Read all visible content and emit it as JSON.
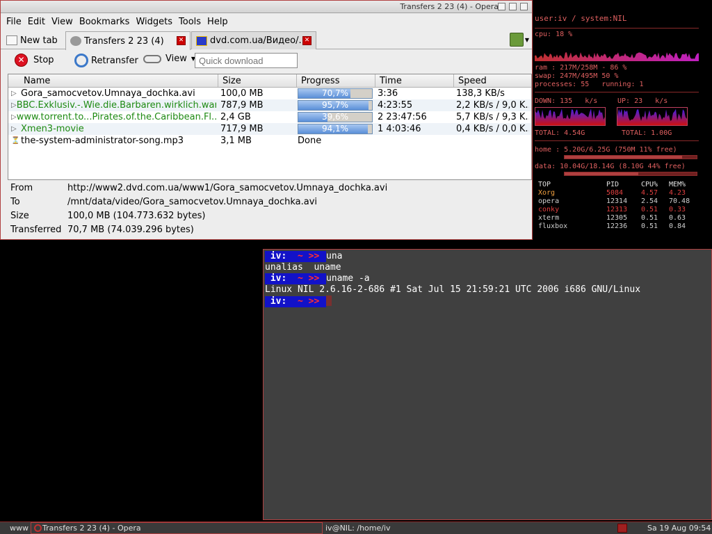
{
  "opera": {
    "title": "Transfers 2 23 (4) - Opera",
    "menu": [
      "File",
      "Edit",
      "View",
      "Bookmarks",
      "Widgets",
      "Tools",
      "Help"
    ],
    "tabs": [
      {
        "label": "New tab"
      },
      {
        "label": "Transfers 2 23 (4)"
      },
      {
        "label": "dvd.com.ua/Видео/..."
      }
    ],
    "toolbar": {
      "stop": "Stop",
      "retransfer": "Retransfer",
      "view": "View",
      "quick_download_placeholder": "Quick download"
    },
    "columns": [
      "Name",
      "Size",
      "Progress",
      "Time",
      "Speed"
    ],
    "rows": [
      {
        "name": "Gora_samocvetov.Umnaya_dochka.avi",
        "size": "100,0 MB",
        "progress": "70,7%",
        "progress_value": 70.7,
        "time": "3:36",
        "speed": "138,3 KB/s",
        "active": true
      },
      {
        "name": "BBC.Exklusiv.-.Wie.die.Barbaren.wirklich.war...",
        "size": "787,9 MB",
        "progress": "95,7%",
        "progress_value": 95.7,
        "time": "4:23:55",
        "speed": "2,2 KB/s / 9,0 K...",
        "active": true
      },
      {
        "name": "www.torrent.to...Pirates.of.the.Caribbean.Fl...",
        "size": "2,4 GB",
        "progress": "39,6%",
        "progress_value": 39.6,
        "time": "2 23:47:56",
        "speed": "5,7 KB/s / 9,3 K...",
        "active": true
      },
      {
        "name": "Xmen3-movie",
        "size": "717,9 MB",
        "progress": "94,1%",
        "progress_value": 94.1,
        "time": "1 4:03:46",
        "speed": "0,4 KB/s / 0,0 K...",
        "active": true
      },
      {
        "name": "the-system-administrator-song.mp3",
        "size": "3,1 MB",
        "progress": "Done",
        "progress_value": 100,
        "time": "",
        "speed": "",
        "active": false
      }
    ],
    "details": {
      "from_label": "From",
      "from": "http://www2.dvd.com.ua/www1/Gora_samocvetov.Umnaya_dochka.avi",
      "to_label": "To",
      "to": "/mnt/data/video/Gora_samocvetov.Umnaya_dochka.avi",
      "size_label": "Size",
      "size": "100,0 MB (104.773.632 bytes)",
      "transferred_label": "Transferred",
      "transferred": "70,7 MB (74.039.296 bytes)"
    }
  },
  "conky": {
    "header": "user:iv / system:NIL",
    "cpu": "cpu: 18 %",
    "ram": "ram : 217M/258M - 86 %",
    "swap": "swap: 247M/495M 50 %",
    "processes": "processes: 55   running: 1",
    "down": "DOWN: 135   k/s",
    "up": "UP: 23   k/s",
    "total_down": "TOTAL: 4.54G",
    "total_up": "TOTAL: 1.00G",
    "home": "home : 5.20G/6.25G (750M 11% free)",
    "home_used": 0.89,
    "data": "data: 10.04G/18.14G (8.10G 44% free)",
    "data_used": 0.56,
    "top_headers": [
      "TOP",
      "PID",
      "CPU%",
      "MEM%"
    ],
    "top": [
      [
        "Xorg",
        "5084",
        "4.57",
        "4.23"
      ],
      [
        "opera",
        "12314",
        "2.54",
        "70.48"
      ],
      [
        "conky",
        "12313",
        "0.51",
        "0.33"
      ],
      [
        "xterm",
        "12305",
        "0.51",
        "0.63"
      ],
      [
        "fluxbox",
        "12236",
        "0.51",
        "0.84"
      ]
    ]
  },
  "terminal": {
    "prompt_user": "iv:",
    "prompt_tilde": "~",
    "prompt_arrows": ">>",
    "lines": [
      {
        "prompt": true,
        "text": "una"
      },
      {
        "prompt": false,
        "text": "unalias  uname"
      },
      {
        "prompt": true,
        "text": "uname -a"
      },
      {
        "prompt": false,
        "text": "Linux NIL 2.6.16-2-686 #1 Sat Jul 15 21:59:21 UTC 2006 i686 GNU/Linux"
      },
      {
        "prompt": true,
        "text": ""
      }
    ]
  },
  "taskbar": {
    "workspace": "www",
    "task1": "Transfers 2 23 (4) - Opera",
    "task2": "iv@NIL: /home/iv",
    "clock": "Sa 19 Aug 09:54"
  }
}
